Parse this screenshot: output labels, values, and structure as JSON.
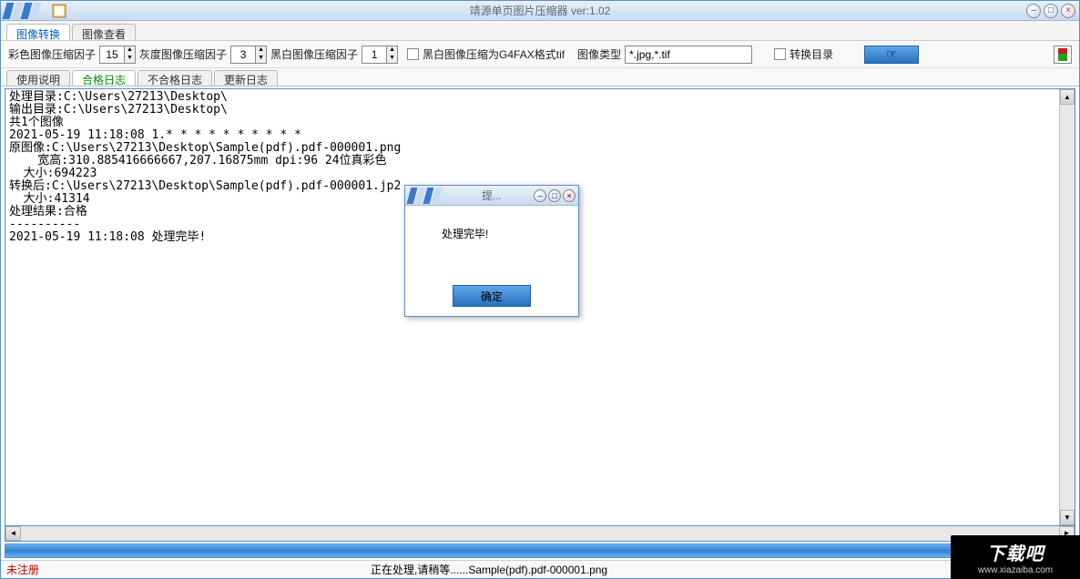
{
  "window": {
    "title": "靖源单页图片压缩器 ver:1.02"
  },
  "mainTabs": [
    {
      "label": "图像转换",
      "active": true
    },
    {
      "label": "图像查看",
      "active": false
    }
  ],
  "toolbar": {
    "colorFactorLabel": "彩色图像压缩因子",
    "colorFactorValue": "15",
    "grayFactorLabel": "灰度图像压缩因子",
    "grayFactorValue": "3",
    "bwFactorLabel": "黑白图像压缩因子",
    "bwFactorValue": "1",
    "bwG4FaxLabel": "黑白图像压缩为G4FAX格式tif",
    "imageTypeLabel": "图像类型",
    "imageTypeValue": "*.jpg,*.tif",
    "convertDirLabel": "转换目录"
  },
  "subTabs": [
    {
      "label": "使用说明",
      "active": false
    },
    {
      "label": "合格日志",
      "active": true
    },
    {
      "label": "不合格日志",
      "active": false
    },
    {
      "label": "更新日志",
      "active": false
    }
  ],
  "log": "处理目录:C:\\Users\\27213\\Desktop\\\n输出目录:C:\\Users\\27213\\Desktop\\\n共1个图像\n2021-05-19 11:18:08 1.* * * * * * * * * *\n原图像:C:\\Users\\27213\\Desktop\\Sample(pdf).pdf-000001.png\n    宽高:310.885416666667,207.16875mm dpi:96 24位真彩色\n  大小:694223\n转换后:C:\\Users\\27213\\Desktop\\Sample(pdf).pdf-000001.jp2\n  大小:41314\n处理结果:合格\n----------\n2021-05-19 11:18:08 处理完毕!",
  "dialog": {
    "title": "提...",
    "message": "处理完毕!",
    "okLabel": "确定"
  },
  "status": {
    "left": "未注册",
    "mid": "正在处理,请稍等......Sample(pdf).pdf-000001.png"
  },
  "watermark": {
    "main": "下载吧",
    "url": "www.xiazaiba.com"
  }
}
